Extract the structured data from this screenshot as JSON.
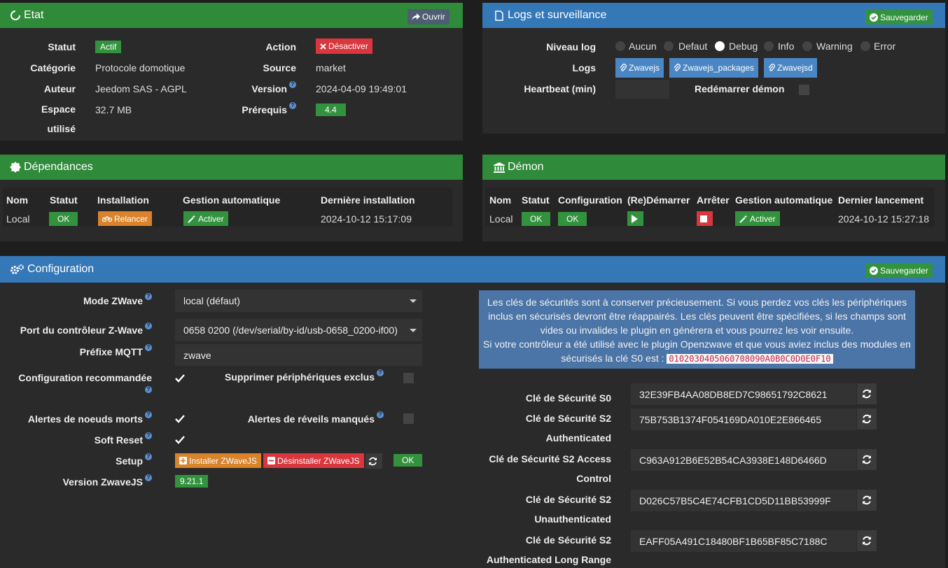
{
  "etat": {
    "title": "Etat",
    "open_label": "Ouvrir",
    "rows": {
      "statut_label": "Statut",
      "statut_value": "Actif",
      "categorie_label": "Catégorie",
      "categorie_value": "Protocole domotique",
      "auteur_label": "Auteur",
      "auteur_value": "Jeedom SAS - AGPL",
      "espace_label_1": "Espace",
      "espace_label_2": "utilisé",
      "espace_value": "32.7 MB",
      "action_label": "Action",
      "action_button": "Désactiver",
      "source_label": "Source",
      "source_value": "market",
      "version_label": "Version",
      "version_value": "2024-04-09 19:49:01",
      "prerequis_label": "Prérequis",
      "prerequis_value": "4.4"
    }
  },
  "logs": {
    "title": "Logs et surveillance",
    "save_label": "Sauvegarder",
    "niveau_label": "Niveau log",
    "levels": [
      "Aucun",
      "Defaut",
      "Debug",
      "Info",
      "Warning",
      "Error"
    ],
    "selected_level": "Debug",
    "logs_label": "Logs",
    "log_buttons": [
      "Zwavejs",
      "Zwavejs_packages",
      "Zwavejsd"
    ],
    "heartbeat_label": "Heartbeat (min)",
    "heartbeat_value": "",
    "restart_label": "Redémarrer démon"
  },
  "deps": {
    "title": "Dépendances",
    "headers": [
      "Nom",
      "Statut",
      "Installation",
      "Gestion automatique",
      "Dernière installation"
    ],
    "row": {
      "nom": "Local",
      "statut": "OK",
      "installation": "Relancer",
      "gestion": "Activer",
      "derniere": "2024-10-12 15:17:09"
    }
  },
  "demon": {
    "title": "Démon",
    "headers": [
      "Nom",
      "Statut",
      "Configuration",
      "(Re)Démarrer",
      "Arrêter",
      "Gestion automatique",
      "Dernier lancement"
    ],
    "row": {
      "nom": "Local",
      "statut": "OK",
      "configuration": "OK",
      "gestion": "Activer",
      "dernier": "2024-10-12 15:27:18"
    }
  },
  "config": {
    "title": "Configuration",
    "save_label": "Sauvegarder",
    "mode_label": "Mode ZWave",
    "mode_value": "local (défaut)",
    "port_label": "Port du contrôleur Z-Wave",
    "port_value": "0658 0200 (/dev/serial/by-id/usb-0658_0200-if00)",
    "prefix_label": "Préfixe MQTT",
    "prefix_value": "zwave",
    "reco_label": "Configuration recommandée",
    "suppr_label": "Supprimer périphériques exclus",
    "alertes_morts_label": "Alertes de noeuds morts",
    "alertes_reveils_label": "Alertes de réveils manqués",
    "soft_reset_label": "Soft Reset",
    "setup_label": "Setup",
    "install_label": "Installer ZWaveJS",
    "uninstall_label": "Désinstaller ZWaveJS",
    "setup_status": "OK",
    "version_label": "Version ZwaveJS",
    "version_value": "9.21.1",
    "info_text_1": "Les clés de sécurités sont à conserver précieusement. Si vous perdez vos clés les périphériques inclus en sécurisés devront être réappairés. Les clés peuvent être spécifiées, si les champs sont vides ou invalides le plugin en générera et vous pourrez les voir ensuite.",
    "info_text_2": "Si votre contrôleur a été utilisé avec le plugin Openzwave et que vous aviez inclus des modules en sécurisés la clé S0 est :",
    "info_code": "0102030405060708090A0B0C0D0E0F10",
    "keys": [
      {
        "label_1": "Clé de Sécurité S0",
        "label_2": "",
        "value": "32E39FB4AA08DB8ED7C98651792C8621"
      },
      {
        "label_1": "Clé de Sécurité S2",
        "label_2": "Authenticated",
        "value": "75B753B1374F054169DA010E2E866465"
      },
      {
        "label_1": "Clé de Sécurité S2 Access",
        "label_2": "Control",
        "value": "C963A912B6E52B54CA3938E148D6466D"
      },
      {
        "label_1": "Clé de Sécurité S2",
        "label_2": "Unauthenticated",
        "value": "D026C57B5C4E74CFB1CD5D11BB53999F"
      },
      {
        "label_1": "Clé de Sécurité S2",
        "label_2": "Authenticated Long Range",
        "value": "EAFF05A491C18480BF1B65BF85C7188C"
      }
    ]
  }
}
